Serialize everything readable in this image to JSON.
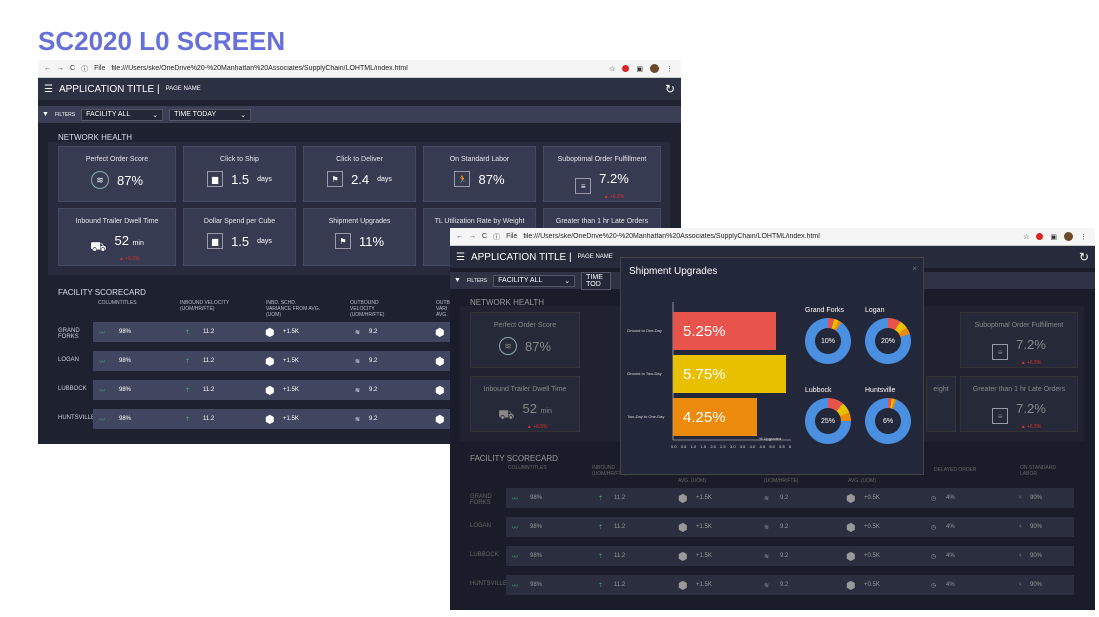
{
  "slide_title": "SC2020 L0 SCREEN",
  "browser": {
    "url": "file:///Users/ske/OneDrive%20-%20Manhattan%20Associates/SupplyChain/LOHTML/index.html",
    "file_label": "File"
  },
  "app": {
    "title": "APPLICATION TITLE |",
    "page_name": "PAGE NAME"
  },
  "filters": {
    "label": "FILTERS",
    "facility": "FACILITY ALL",
    "time": "TIME TODAY",
    "time_short": "TIME TOD"
  },
  "network_health": {
    "title": "NETWORK HEALTH",
    "cards": [
      {
        "title": "Perfect Order Score",
        "value": "87%",
        "unit": ""
      },
      {
        "title": "Click to Ship",
        "value": "1.5",
        "unit": "days"
      },
      {
        "title": "Click to Deliver",
        "value": "2.4",
        "unit": "days"
      },
      {
        "title": "On Standard Labor",
        "value": "87%",
        "unit": ""
      },
      {
        "title": "Suboptimal Order Fulfillment",
        "value": "7.2%",
        "unit": "",
        "delta": "▲ +6.5%"
      },
      {
        "title": "Inbound Trailer Dwell Time",
        "value": "52",
        "unit": "min",
        "delta": "▲ +6.5%"
      },
      {
        "title": "Dollar Spend per Cube",
        "value": "1.5",
        "unit": "days"
      },
      {
        "title": "Shipment Upgrades",
        "value": "11%",
        "unit": ""
      },
      {
        "title": "TL Utilization Rate by Weight",
        "value": "",
        "unit": ""
      },
      {
        "title": "Greater than 1 hr Late Orders",
        "value": "",
        "unit": ""
      }
    ],
    "second_cards": [
      {
        "title": "Perfect Order Score",
        "value": "87%"
      },
      {
        "title": "Suboptimal Order Fulfillment",
        "value": "7.2%",
        "delta": "▲ +6.5%"
      },
      {
        "title": "Inbound Trailer Dwell Time",
        "value": "52",
        "unit": "min",
        "delta": "▲ +6.5%"
      },
      {
        "title": "Greater than 1 hr Late Orders",
        "value": "7.2%",
        "delta": "▲ +6.5%"
      },
      {
        "title": "eight",
        "value": ""
      }
    ]
  },
  "scorecard": {
    "title": "FACILITY SCORECARD",
    "columns": [
      "COLUMNTITLES",
      "INBOUND VELOCITY (UOM/HR/FTE)",
      "INBD. SCHD. VARIANCE FROM AVG. (UOM)",
      "OUTBOUND VELOCITY (UOM/HR/FTE)",
      "OUTB VARI AVG."
    ],
    "columns2": [
      "COLUMNTITLES",
      "INBOUND (UOM/HR/FTE)",
      "AVG. (UOM)",
      "(UOM/HR/FTE)",
      "AVG. (UOM)",
      "DELAYED ORDER",
      "ON STANDARD LABOR"
    ],
    "rows": [
      {
        "name": "GRAND FORKS",
        "score": "98%",
        "inbound": "11.2",
        "variance": "+1.5K",
        "outbound": "9.2",
        "out_var": "+0.5K",
        "delayed": "4%",
        "labor": "90%"
      },
      {
        "name": "LOGAN",
        "score": "98%",
        "inbound": "11.2",
        "variance": "+1.5K",
        "outbound": "9.2",
        "out_var": "+0.5K",
        "delayed": "4%",
        "labor": "90%"
      },
      {
        "name": "LUBBOCK",
        "score": "98%",
        "inbound": "11.2",
        "variance": "+1.5K",
        "outbound": "9.2",
        "out_var": "+0.5K",
        "delayed": "4%",
        "labor": "90%"
      },
      {
        "name": "HUNTSVILLE",
        "score": "98%",
        "inbound": "11.2",
        "variance": "+1.5K",
        "outbound": "9.2",
        "out_var": "+0.5K",
        "delayed": "4%",
        "labor": "90%"
      }
    ]
  },
  "modal": {
    "title": "Shipment Upgrades",
    "close": "×"
  },
  "chart_data": [
    {
      "type": "bar",
      "orientation": "horizontal",
      "categories": [
        "Ground to One-Day",
        "Ground to Two-Day",
        "Two-Day to One-Day"
      ],
      "values": [
        5.25,
        5.75,
        4.25
      ],
      "data_labels": [
        "5.25%",
        "5.75%",
        "4.25%"
      ],
      "colors": [
        "#e8534c",
        "#e8c000",
        "#ec8a0c"
      ],
      "xlabel": "% Upgraded",
      "xticks": [
        "0.0",
        "0.5",
        "1.0",
        "1.5",
        "2.0",
        "2.5",
        "3.0",
        "3.5",
        "4.0",
        "4.5",
        "5.0",
        "5.5",
        "6"
      ],
      "xlim": [
        0,
        6
      ]
    },
    {
      "type": "pie",
      "title": "Grand Forks",
      "center_label": "10%",
      "values": [
        10,
        90
      ]
    },
    {
      "type": "pie",
      "title": "Logan",
      "center_label": "20%",
      "values": [
        20,
        80
      ]
    },
    {
      "type": "pie",
      "title": "Lubbock",
      "center_label": "25%",
      "values": [
        25,
        75
      ]
    },
    {
      "type": "pie",
      "title": "Huntsville",
      "center_label": "6%",
      "values": [
        6,
        94
      ]
    }
  ],
  "colors": {
    "accent": "#6670d8",
    "donut_main": "#4a8fe0",
    "donut_red": "#e8534c",
    "donut_yellow": "#e8c000",
    "donut_orange": "#ec8a0c",
    "delta": "#e03030"
  }
}
